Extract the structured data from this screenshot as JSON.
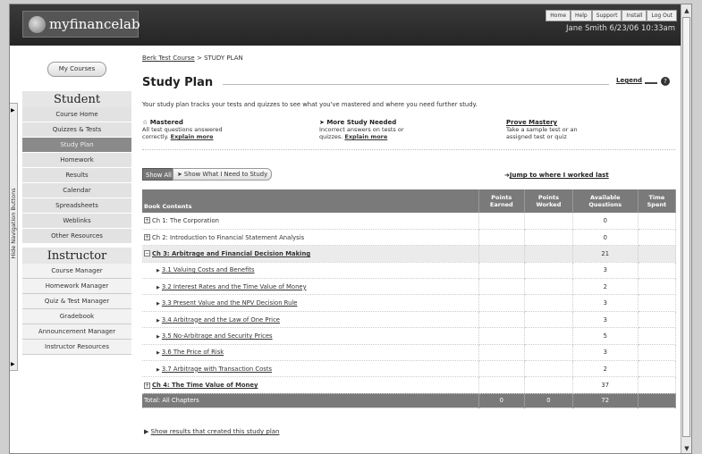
{
  "header": {
    "logo_text": "myfinancelab",
    "top_links": [
      "Home",
      "Help",
      "Support",
      "Install",
      "Log Out"
    ],
    "user_line": "Jane Smith 6/23/06 10:33am"
  },
  "side_tab_label": "Hide Navigation Buttons",
  "sidebar": {
    "my_courses": "My Courses",
    "student_title": "Student",
    "student_items": [
      "Course Home",
      "Quizzes & Tests",
      "Study Plan",
      "Homework",
      "Results",
      "Calendar",
      "Spreadsheets",
      "Weblinks",
      "Other Resources"
    ],
    "instructor_title": "Instructor",
    "instructor_items": [
      "Course Manager",
      "Homework Manager",
      "Quiz & Test Manager",
      "Gradebook",
      "Announcement Manager",
      "Instructor Resources"
    ]
  },
  "breadcrumb": {
    "course": "Berk Test Course",
    "sep": ">",
    "current": "STUDY PLAN"
  },
  "page": {
    "title": "Study Plan",
    "legend": "Legend",
    "intro": "Your study plan tracks your tests and quizzes to see what you've mastered and where you need further study."
  },
  "stats": {
    "mastered_title": "Mastered",
    "mastered_text": "All test questions answered",
    "mastered_text2": "correctly.",
    "more_title": "More Study Needed",
    "more_text": "Incorrect answers on tests or",
    "more_text2": "quizzes.",
    "explain": "Explain more",
    "prove_title": "Prove Mastery",
    "prove_text": "Take a sample test or an",
    "prove_text2": "assigned test or quiz"
  },
  "controls": {
    "show_all": "Show All",
    "show_need": "Show What I Need to Study",
    "jump": "Jump to where I worked last"
  },
  "table": {
    "headers": [
      "Book Contents",
      "Points Earned",
      "Points Worked",
      "Available Questions",
      "Time Spent"
    ],
    "rows": [
      {
        "name": "Ch 1: The Corporation",
        "available": "0"
      },
      {
        "name": "Ch 2: Introduction to Financial Statement Analysis",
        "available": "0"
      },
      {
        "name": "Ch 3: Arbitrage and Financial Decision Making",
        "available": "21"
      },
      {
        "name": "3.1 Valuing Costs and Benefits",
        "available": "3"
      },
      {
        "name": "3.2 Interest Rates and the Time Value of Money",
        "available": "2"
      },
      {
        "name": "3.3 Present Value and the NPV Decision Rule",
        "available": "3"
      },
      {
        "name": "3.4 Arbitrage and the Law of One Price",
        "available": "3"
      },
      {
        "name": "3.5 No-Arbitrage and Security Prices",
        "available": "5"
      },
      {
        "name": "3.6 The Price of Risk",
        "available": "3"
      },
      {
        "name": "3.7 Arbitrage with Transaction Costs",
        "available": "2"
      },
      {
        "name": "Ch 4: The Time Value of Money",
        "available": "37"
      }
    ],
    "total": {
      "label": "Total: All Chapters",
      "earned": "0",
      "worked": "0",
      "available": "72"
    }
  },
  "show_results": "Show results that created this study plan"
}
